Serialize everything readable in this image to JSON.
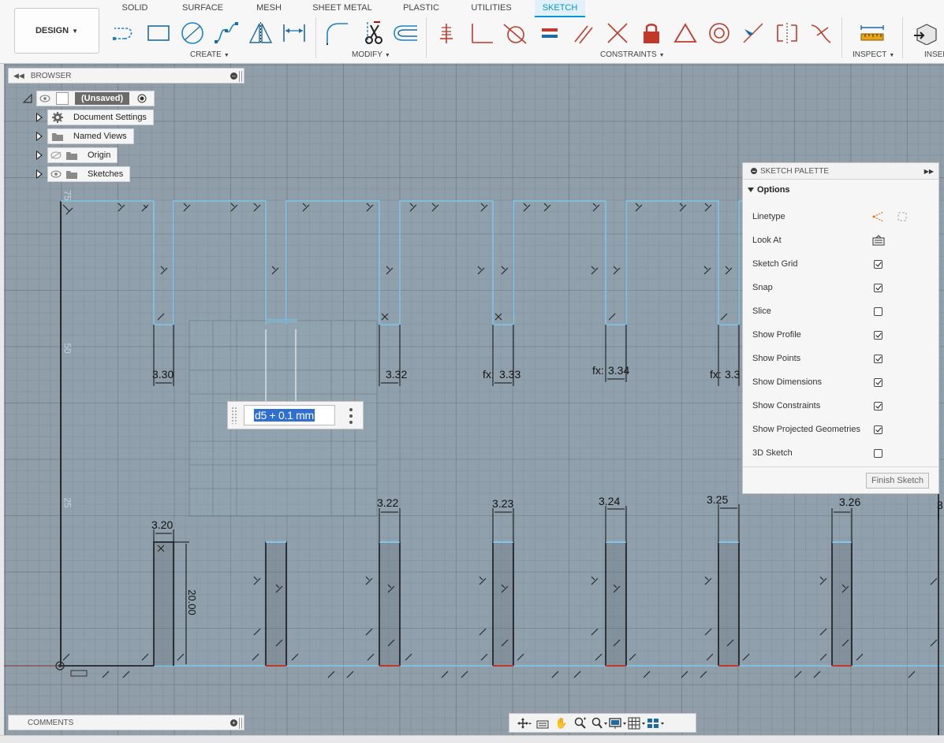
{
  "workspace": {
    "label": "DESIGN"
  },
  "tabs": [
    {
      "label": "SOLID"
    },
    {
      "label": "SURFACE"
    },
    {
      "label": "MESH"
    },
    {
      "label": "SHEET METAL"
    },
    {
      "label": "PLASTIC"
    },
    {
      "label": "UTILITIES"
    },
    {
      "label": "SKETCH",
      "active": true
    }
  ],
  "groups": {
    "create": "CREATE",
    "modify": "MODIFY",
    "constraints": "CONSTRAINTS",
    "inspect": "INSPECT",
    "insert": "INSER"
  },
  "browser": {
    "title": "BROWSER",
    "root": "(Unsaved)",
    "items": [
      {
        "label": "Document Settings",
        "icon": "gear-icon"
      },
      {
        "label": "Named Views",
        "icon": "folder-icon"
      },
      {
        "label": "Origin",
        "icon": "folder-icon",
        "hidden": true
      },
      {
        "label": "Sketches",
        "icon": "folder-icon"
      }
    ]
  },
  "palette": {
    "title": "SKETCH PALETTE",
    "section": "Options",
    "options": [
      {
        "label": "Linetype",
        "kind": "icons"
      },
      {
        "label": "Look At",
        "kind": "icon"
      },
      {
        "label": "Sketch Grid",
        "checked": true
      },
      {
        "label": "Snap",
        "checked": true
      },
      {
        "label": "Slice",
        "checked": false
      },
      {
        "label": "Show Profile",
        "checked": true
      },
      {
        "label": "Show Points",
        "checked": true
      },
      {
        "label": "Show Dimensions",
        "checked": true
      },
      {
        "label": "Show Constraints",
        "checked": true
      },
      {
        "label": "Show Projected Geometries",
        "checked": true
      },
      {
        "label": "3D Sketch",
        "checked": false
      }
    ],
    "finish_label": "Finish Sketch"
  },
  "dimension_input": {
    "value": "d5 + 0.1 mm"
  },
  "comments": {
    "title": "COMMENTS"
  },
  "canvas": {
    "ruler": [
      "75",
      "50",
      "25"
    ],
    "top_dims": [
      "3.30",
      "3.32",
      "3.33",
      "3.34",
      "3.3"
    ],
    "top_fx": [
      "fx:",
      "fx:",
      "fx:"
    ],
    "bottom_dims": [
      "3.20",
      "3.22",
      "3.23",
      "3.24",
      "3.25",
      "3.26",
      "3"
    ],
    "height_dim": "20.00"
  },
  "colors": {
    "accent": "#0696d7",
    "sketch_line": "#7ec8ee",
    "canvas": "#8f9ea9",
    "selection": "#2f6fd1"
  }
}
